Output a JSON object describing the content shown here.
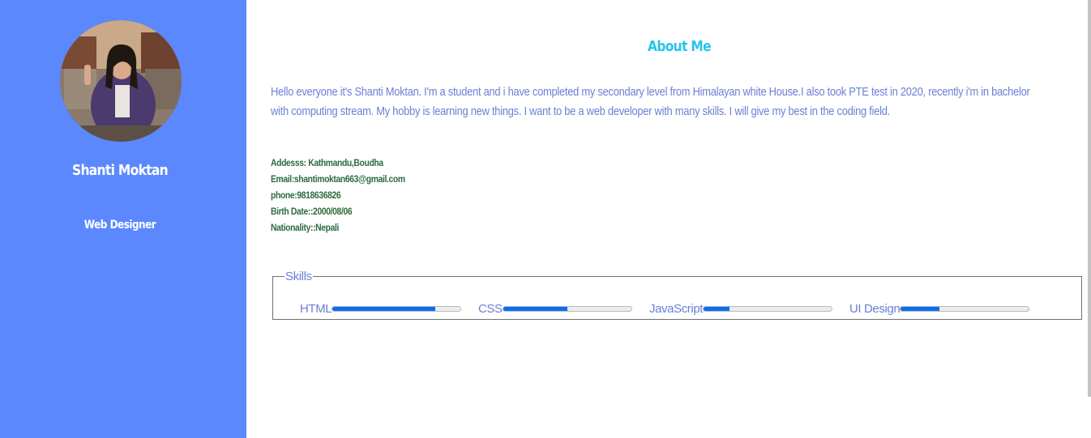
{
  "profile": {
    "name": "Shanti Moktan",
    "role": "Web Designer"
  },
  "about": {
    "title": "About Me",
    "lines": [
      "Hello everyone it's Shanti Moktan. I'm a student and i have completed my secondary level from Himalayan white House.I also took PTE test in 2020, recently i'm in bachelor",
      "with computing stream. My hobby is learning new things. I want to be a web developer with many skills. I will give my best in the coding field."
    ]
  },
  "info": {
    "address": "Addesss: Kathmandu,Boudha",
    "email": "Email:shantimoktan663@gmail.com",
    "phone": "phone:9818636826",
    "birth": "Birth Date::2000/08/06",
    "nationality": "Nationality::Nepali"
  },
  "skills": {
    "legend": "Skills",
    "items": [
      {
        "label": "HTML",
        "level": 0.8
      },
      {
        "label": "CSS",
        "level": 0.5
      },
      {
        "label": "JavaScript",
        "level": 0.2
      },
      {
        "label": "UI Design",
        "level": 0.3
      }
    ]
  },
  "colors": {
    "sidebar": "#5b88fd",
    "title": "#27c4ee",
    "text": "#6b7fd6",
    "info": "#2d6b3c",
    "bar_fill": "#0a6ff0"
  }
}
